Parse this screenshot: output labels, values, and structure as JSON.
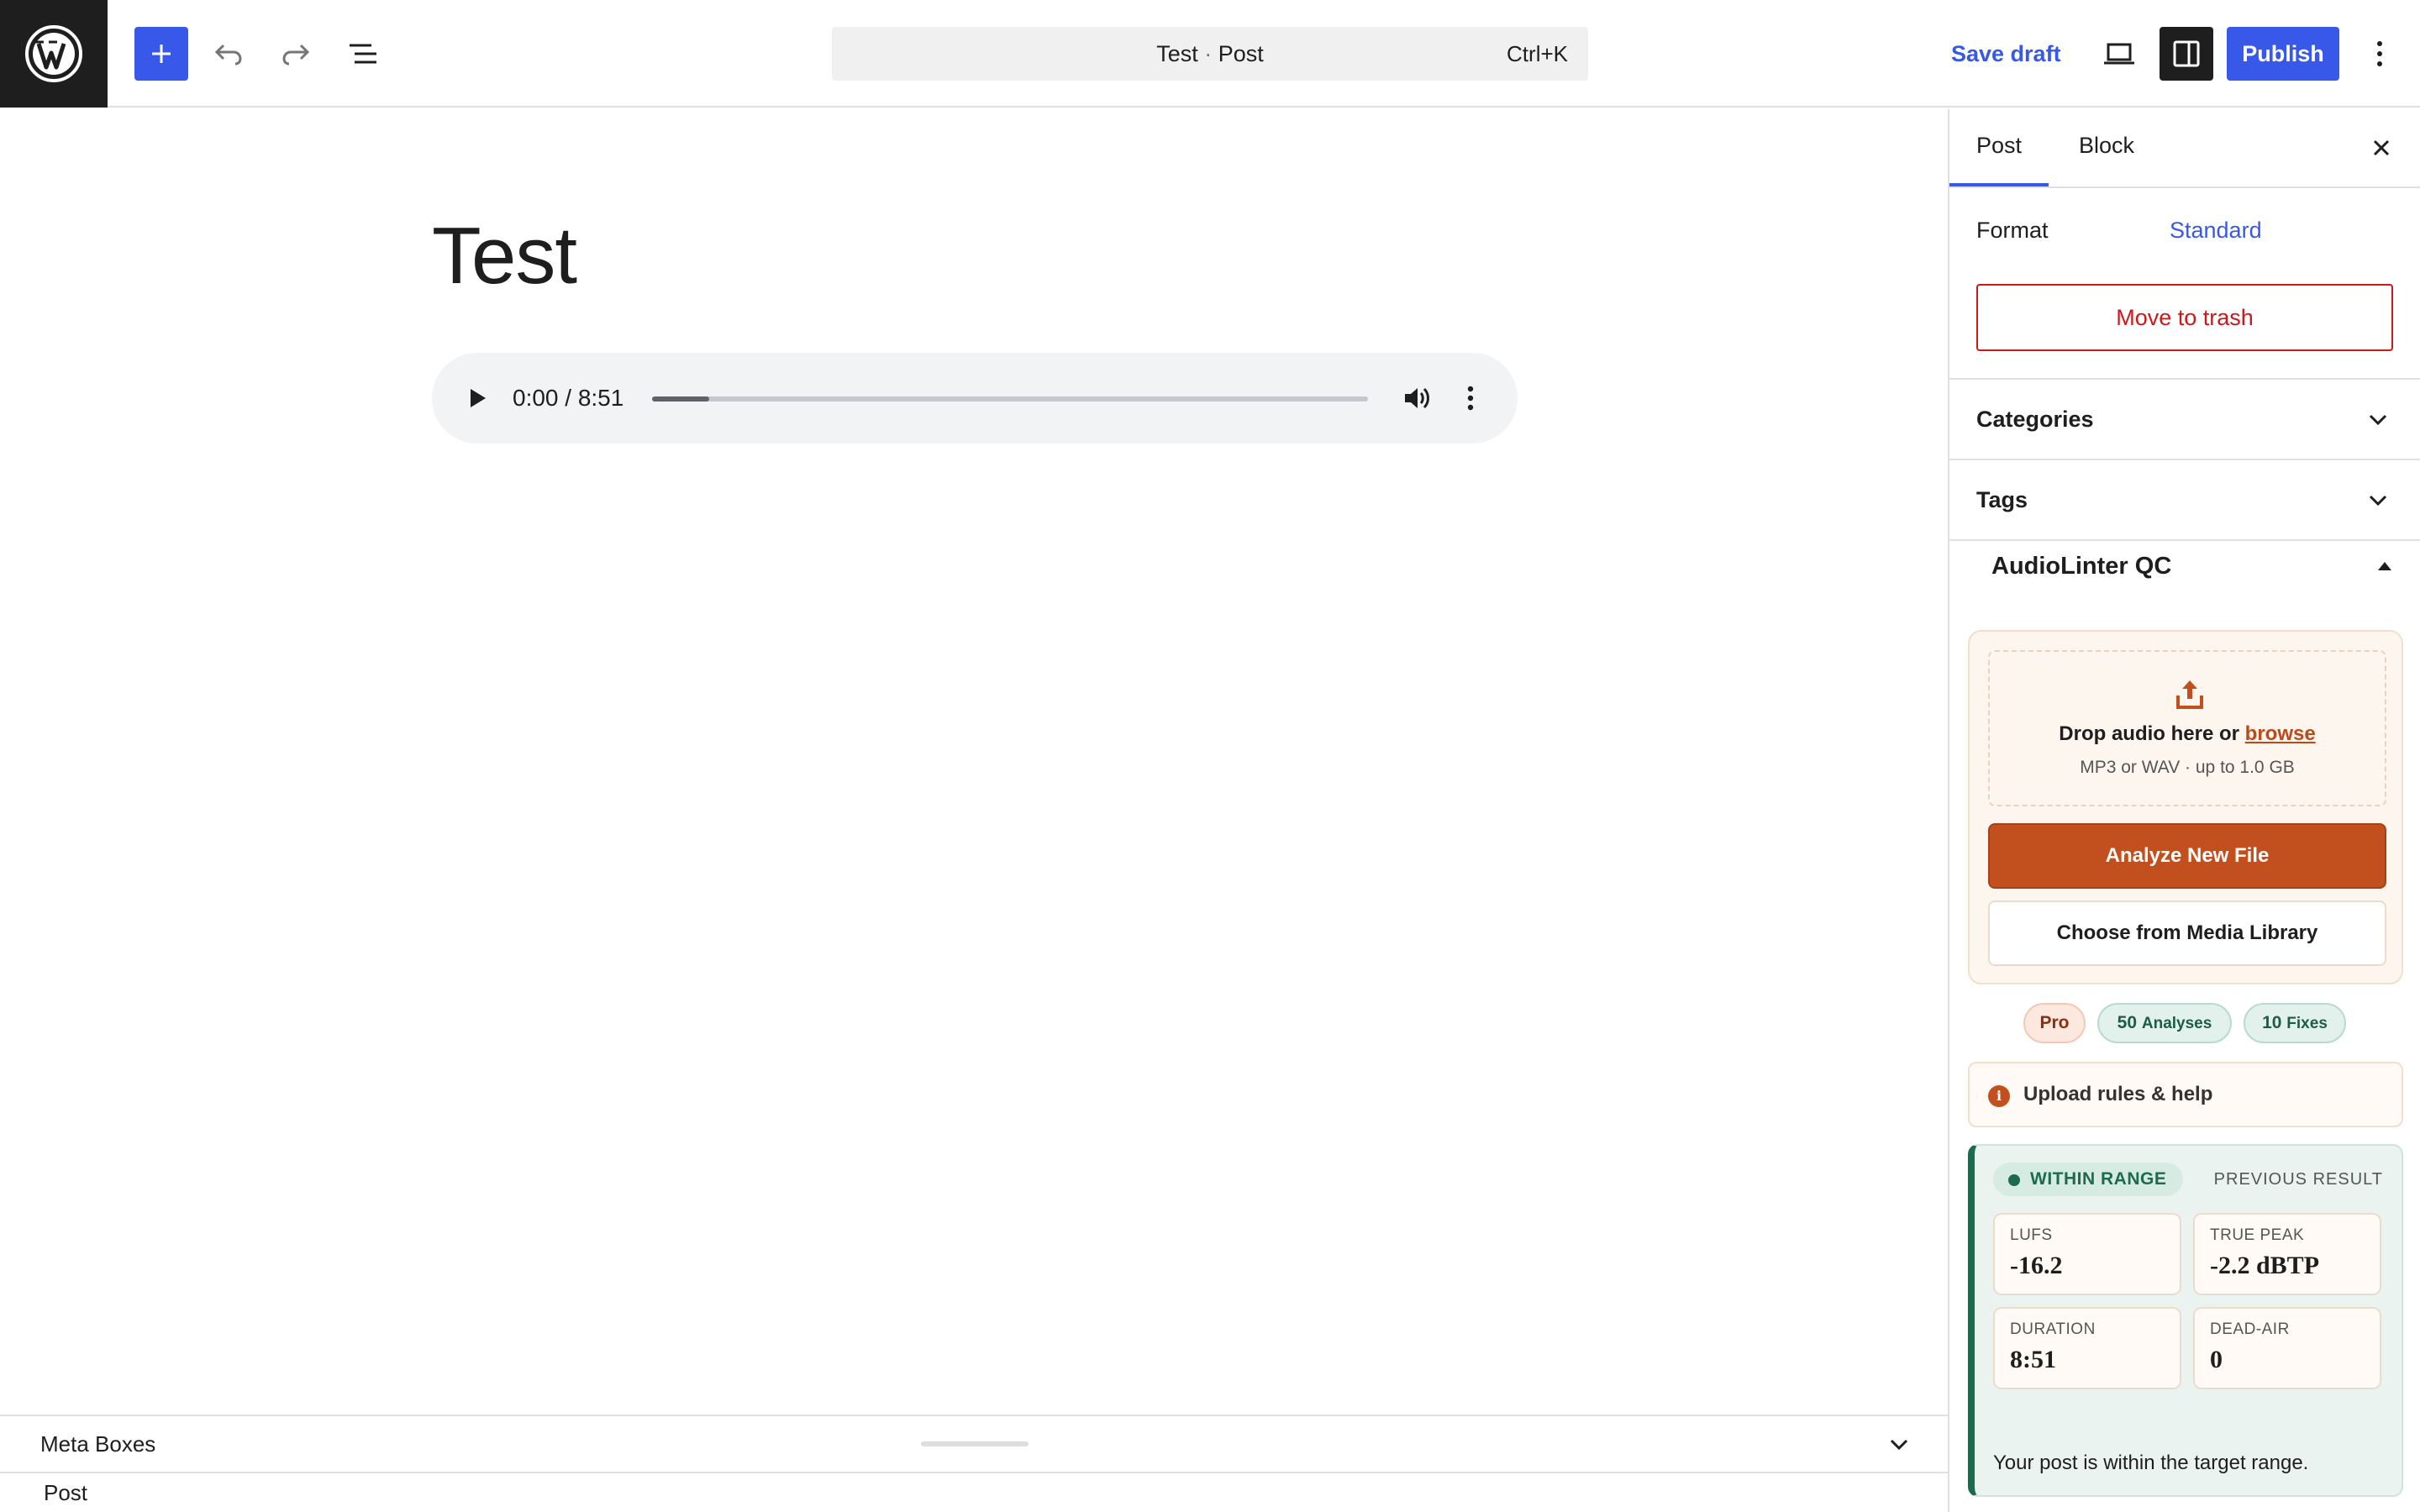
{
  "topbar": {
    "add_label": "Add block",
    "command_title": "Test",
    "command_sep": " · ",
    "command_type": "Post",
    "command_shortcut": "Ctrl+K",
    "save_draft": "Save draft",
    "publish": "Publish"
  },
  "editor": {
    "post_title": "Test",
    "audio": {
      "time": "0:00 / 8:51",
      "progress_fraction": 0.08
    }
  },
  "metabox": {
    "label": "Meta Boxes",
    "status": "Post"
  },
  "sidebar": {
    "tabs": [
      "Post",
      "Block"
    ],
    "format_label": "Format",
    "format_value": "Standard",
    "trash": "Move to trash",
    "panels": [
      "Categories",
      "Tags"
    ]
  },
  "audiolinter": {
    "title": "AudioLinter QC",
    "drop_text": "Drop audio here or",
    "drop_link": "browse",
    "drop_sub": "MP3 or WAV · up to 1.0 GB",
    "analyze": "Analyze New File",
    "library": "Choose from Media Library",
    "badges": {
      "plan": "Pro",
      "analyses_count": "50",
      "analyses_unit": "Analyses",
      "fixes_count": "10",
      "fixes_unit": "Fixes"
    },
    "help_icon": "i",
    "help": "Upload rules & help",
    "result": {
      "status": "WITHIN RANGE",
      "tag": "PREVIOUS RESULT",
      "metrics": [
        {
          "label": "LUFS",
          "value": "-16.2"
        },
        {
          "label": "TRUE PEAK",
          "value": "-2.2 dBTP"
        },
        {
          "label": "DURATION",
          "value": "8:51"
        },
        {
          "label": "DEAD-AIR",
          "value": "0"
        }
      ],
      "message": "Your post is within the target range."
    }
  },
  "colors": {
    "accent": "#3858e9",
    "danger": "#cc1818",
    "brand_orange": "#c2501f",
    "success": "#1d6b4f"
  }
}
